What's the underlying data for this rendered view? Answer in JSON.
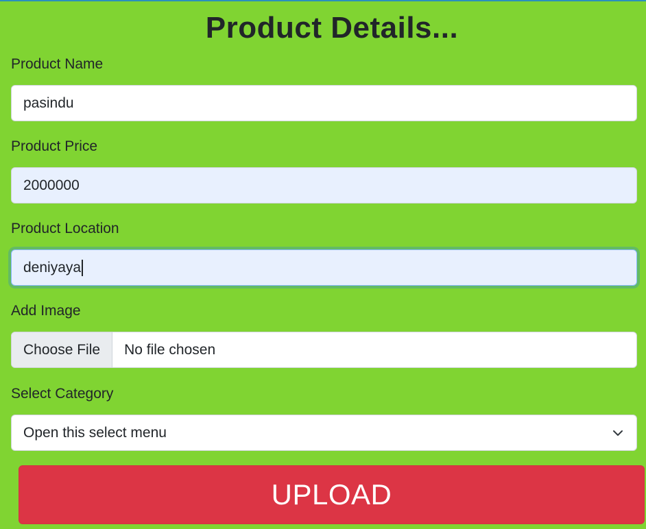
{
  "form": {
    "title": "Product Details...",
    "product_name": {
      "label": "Product Name",
      "value": "pasindu"
    },
    "product_price": {
      "label": "Product Price",
      "value": "2000000"
    },
    "product_location": {
      "label": "Product Location",
      "value": "deniyaya"
    },
    "add_image": {
      "label": "Add Image",
      "button_label": "Choose File",
      "status": "No file chosen"
    },
    "category": {
      "label": "Select Category",
      "selected": "Open this select menu"
    },
    "upload_label": "UPLOAD"
  },
  "colors": {
    "background": "#80d432",
    "upload_button": "#dc3545",
    "autofill": "#e8f0fe"
  },
  "icons": {
    "select_arrow": "chevron-down-icon"
  }
}
